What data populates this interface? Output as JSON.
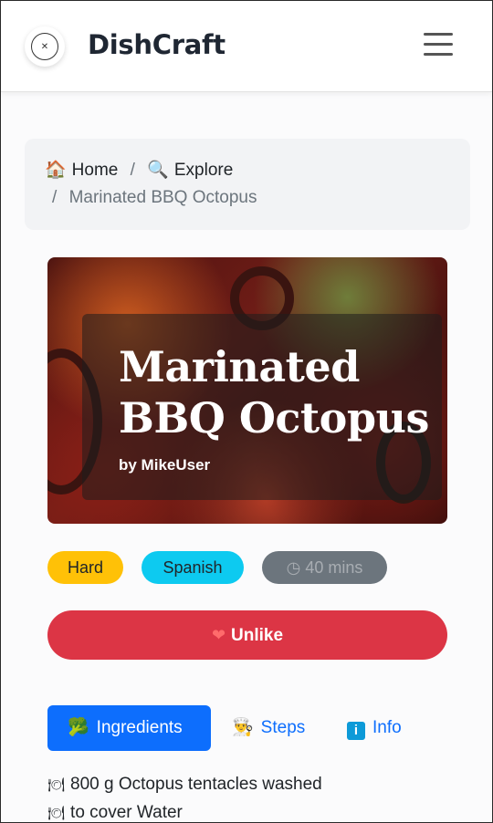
{
  "header": {
    "brand": "DishCraft",
    "logo_icon": "chef-knife-logo",
    "menu_icon": "hamburger-menu-icon"
  },
  "breadcrumb": [
    {
      "icon": "🏠",
      "label": "Home"
    },
    {
      "icon": "🔍",
      "label": "Explore"
    },
    {
      "label": "Marinated BBQ Octopus",
      "current": true
    }
  ],
  "breadcrumb_separator": "/",
  "recipe": {
    "title": "Marinated BBQ Octopus",
    "author": "by MikeUser",
    "difficulty": "Hard",
    "cuisine": "Spanish",
    "time": "40 mins",
    "time_icon": "clock-icon"
  },
  "actions": {
    "unlike_label": "Unlike",
    "unlike_icon": "❤"
  },
  "tabs": [
    {
      "icon": "🥦",
      "label": "Ingredients",
      "active": true
    },
    {
      "icon": "👨‍🍳",
      "label": "Steps"
    },
    {
      "icon": "i",
      "label": "Info"
    }
  ],
  "ingredients": [
    {
      "icon": "🍽",
      "text": "800 g Octopus tentacles washed"
    },
    {
      "icon": "🍽",
      "text": "to cover Water"
    }
  ],
  "colors": {
    "primary": "#0d6efd",
    "danger": "#dc3545",
    "warning": "#ffc107",
    "info": "#0dcaf0",
    "secondary": "#6c757d"
  }
}
